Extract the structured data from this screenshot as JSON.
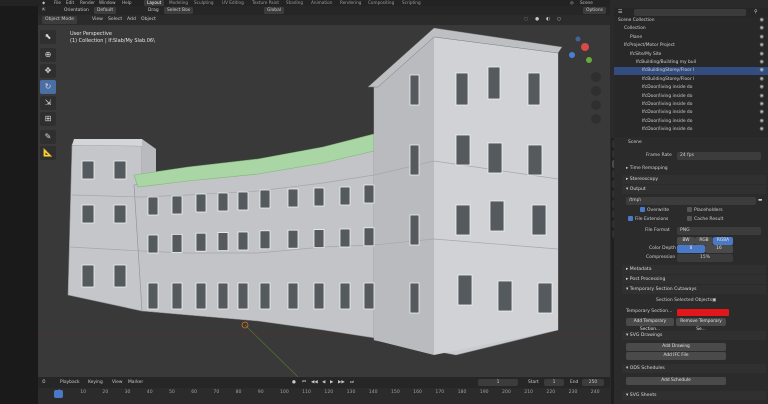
{
  "topbar": {
    "menus": [
      "File",
      "Edit",
      "Render",
      "Window",
      "Help"
    ],
    "workspaces": [
      "Layout",
      "Modeling",
      "Sculpting",
      "UV Editing",
      "Texture Paint",
      "Shading",
      "Animation",
      "Rendering",
      "Compositing",
      "Scripting"
    ],
    "scene": "Scene",
    "view_layer": "View Layer"
  },
  "tool_header": {
    "orientation_label": "Orientation",
    "orientation_value": "Default",
    "drag_label": "Drag",
    "drag_value": "Select Box",
    "transform": "Global",
    "options": "Options"
  },
  "viewport_header": {
    "mode": "Object Mode",
    "menus": [
      "View",
      "Select",
      "Add",
      "Object"
    ]
  },
  "viewport": {
    "view_name": "User Perspective",
    "collection_info": "(1) Collection | If:Slab/My Slab.06\\"
  },
  "outliner": {
    "rows": [
      {
        "label": "Scene Collection",
        "indent": 0
      },
      {
        "label": "Collection",
        "indent": 1
      },
      {
        "label": "Plane",
        "indent": 2
      },
      {
        "label": "IfcProject/Motor Project",
        "indent": 1
      },
      {
        "label": "IfcSite/My Site",
        "indent": 2
      },
      {
        "label": "IfcBuilding/Building my buil",
        "indent": 3
      },
      {
        "label": "IfcBuildingStorey/Floor I",
        "indent": 4
      },
      {
        "label": "IfcBuildingStorey/Floor I",
        "indent": 4
      },
      {
        "label": "IfcDoor/living inside do",
        "indent": 4
      },
      {
        "label": "IfcDoor/living inside do",
        "indent": 4
      },
      {
        "label": "IfcDoor/living inside do",
        "indent": 4
      },
      {
        "label": "IfcDoor/living inside do",
        "indent": 4
      },
      {
        "label": "IfcDoor/living inside do",
        "indent": 4
      },
      {
        "label": "IfcDoor/living inside do",
        "indent": 4
      }
    ]
  },
  "properties": {
    "context": "Scene",
    "frame_rate_label": "Frame Rate",
    "frame_rate": "24 fps",
    "time_remapping": "Time Remapping",
    "stereoscopy": "Stereoscopy",
    "output_title": "Output",
    "output_path": "/tmp\\",
    "overwrite": "Overwrite",
    "placeholders": "Placeholders",
    "file_extensions": "File Extensions",
    "cache_result": "Cache Result",
    "file_format_label": "File Format",
    "file_format": "PNG",
    "color_modes": [
      "BW",
      "RGB",
      "RGBA"
    ],
    "color_depth_label": "Color Depth",
    "color_depths": [
      "8",
      "16"
    ],
    "compression_label": "Compression",
    "compression": "15%",
    "metadata": "Metadata",
    "post_processing": "Post Processing",
    "section_cutaways": "Temporary Section Cutaways",
    "section_selected": "Section Selected Objects",
    "temp_section_label": "Temporary Section...",
    "temp_section_color": "#e3161a",
    "add_temp": "Add Temporary Section...",
    "remove_temp": "Remove Temporary Se...",
    "svg_drawings": "SVG Drawings",
    "add_drawing": "Add Drawing",
    "add_ifc_file": "Add IFC File",
    "ods_schedules": "ODS Schedules",
    "add_schedule": "Add Schedule",
    "svg_sheets": "SVG Sheets"
  },
  "timeline": {
    "menus": [
      "Playback",
      "Keying",
      "View",
      "Marker"
    ],
    "current_frame": "1",
    "start_label": "Start",
    "start": "1",
    "end_label": "End",
    "end": "250",
    "ticks": [
      "1",
      "10",
      "20",
      "30",
      "40",
      "50",
      "60",
      "70",
      "80",
      "90",
      "100",
      "110",
      "120",
      "130",
      "140",
      "150",
      "160",
      "170",
      "180",
      "190",
      "200",
      "210",
      "220",
      "230",
      "240",
      "250"
    ]
  },
  "colors": {
    "accent": "#4a79c7",
    "selected_section": "#a6d8a6",
    "building": "#c9cbce"
  }
}
